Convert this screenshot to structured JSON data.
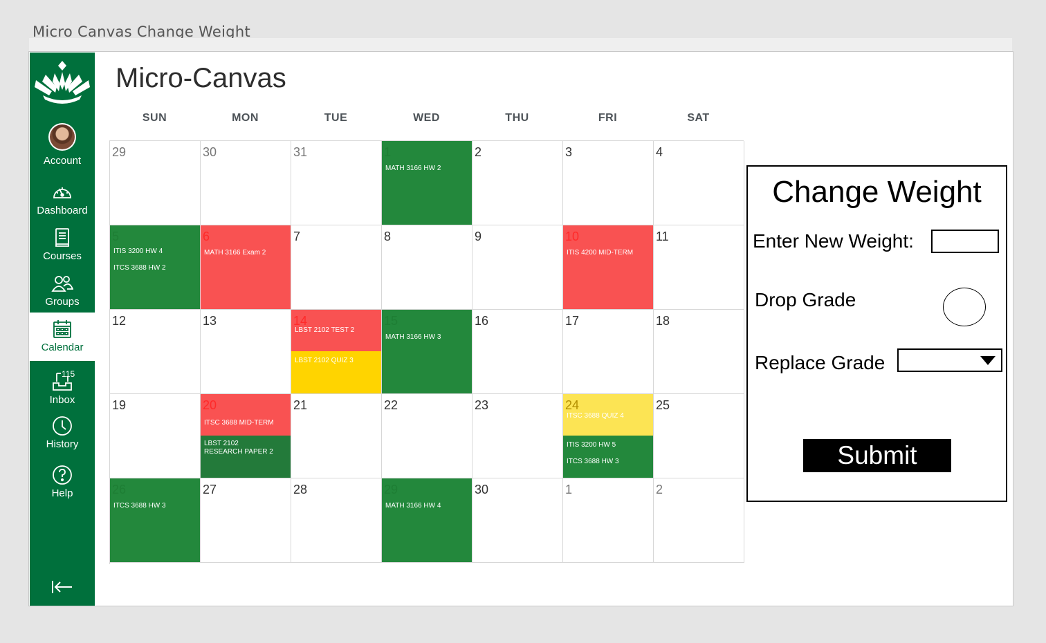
{
  "window_title": "Micro Canvas Change Weight",
  "app_title": "Micro-Canvas",
  "colors": {
    "brand": "#00703c",
    "green": "#23883c",
    "darkgreen": "#237a3a",
    "red": "#f95252",
    "yellow": "#ffd400",
    "lightyellow": "#fce454"
  },
  "sidebar": {
    "items": [
      {
        "label": "Account",
        "icon": "avatar-icon"
      },
      {
        "label": "Dashboard",
        "icon": "dashboard-icon"
      },
      {
        "label": "Courses",
        "icon": "courses-icon"
      },
      {
        "label": "Groups",
        "icon": "groups-icon"
      },
      {
        "label": "Calendar",
        "icon": "calendar-icon",
        "active": true
      },
      {
        "label": "Inbox",
        "icon": "inbox-icon",
        "badge": "115"
      },
      {
        "label": "History",
        "icon": "history-icon"
      },
      {
        "label": "Help",
        "icon": "help-icon"
      }
    ]
  },
  "calendar": {
    "days_of_week": [
      "SUN",
      "MON",
      "TUE",
      "WED",
      "THU",
      "FRI",
      "SAT"
    ],
    "weeks": [
      [
        {
          "day": "29",
          "muted": true
        },
        {
          "day": "30",
          "muted": true
        },
        {
          "day": "31",
          "muted": true
        },
        {
          "day": "1",
          "fill": "green",
          "daycolor": "green",
          "events": [
            {
              "lines": [
                "MATH 3166 HW 2"
              ]
            }
          ]
        },
        {
          "day": "2"
        },
        {
          "day": "3"
        },
        {
          "day": "4"
        }
      ],
      [
        {
          "day": "5",
          "fill": "green",
          "daycolor": "green",
          "events": [
            {
              "lines": [
                "ITIS 3200 HW 4"
              ]
            },
            {
              "lines": [
                "ITCS 3688 HW 2"
              ]
            }
          ]
        },
        {
          "day": "6",
          "fill": "red",
          "daycolor": "red",
          "events": [
            {
              "lines": [
                "MATH 3166 Exam 2"
              ]
            }
          ]
        },
        {
          "day": "7"
        },
        {
          "day": "8"
        },
        {
          "day": "9"
        },
        {
          "day": "10",
          "fill": "red",
          "daycolor": "red",
          "events": [
            {
              "lines": [
                "ITIS 4200 MID-TERM"
              ]
            }
          ]
        },
        {
          "day": "11"
        }
      ],
      [
        {
          "day": "12"
        },
        {
          "day": "13"
        },
        {
          "day": "14",
          "split": [
            "red",
            "yellow"
          ],
          "daycolor": "red",
          "events": [
            {
              "lines": [
                "LBST 2102 TEST 2"
              ]
            },
            {
              "lines": [
                "LBST 2102 QUIZ 3"
              ]
            }
          ]
        },
        {
          "day": "15",
          "fill": "green",
          "daycolor": "green",
          "events": [
            {
              "lines": [
                "MATH 3166 HW 3"
              ]
            }
          ]
        },
        {
          "day": "16"
        },
        {
          "day": "17"
        },
        {
          "day": "18"
        }
      ],
      [
        {
          "day": "19"
        },
        {
          "day": "20",
          "split": [
            "red",
            "darkgreen"
          ],
          "daycolor": "red",
          "events": [
            {
              "lines": [
                "ITSC 3688 MID-TERM"
              ]
            },
            {
              "lines": [
                "LBST 2102",
                "RESEARCH PAPER 2"
              ]
            }
          ]
        },
        {
          "day": "21"
        },
        {
          "day": "22"
        },
        {
          "day": "23"
        },
        {
          "day": "24",
          "split": [
            "lightyellow",
            "green"
          ],
          "daycolor": "gold",
          "events": [
            {
              "lines": [
                "ITSC 3688 QUIZ 4"
              ]
            },
            {
              "lines": [
                "ITIS 3200 HW 5"
              ]
            },
            {
              "lines": [
                "ITCS 3688 HW 3"
              ]
            }
          ]
        },
        {
          "day": "25"
        }
      ],
      [
        {
          "day": "26",
          "fill": "green",
          "daycolor": "green",
          "events": [
            {
              "lines": [
                "ITCS 3688 HW 3"
              ]
            }
          ]
        },
        {
          "day": "27"
        },
        {
          "day": "28"
        },
        {
          "day": "29",
          "fill": "green",
          "daycolor": "green",
          "events": [
            {
              "lines": [
                "MATH 3166 HW 4"
              ]
            }
          ]
        },
        {
          "day": "30"
        },
        {
          "day": "1",
          "muted": true
        },
        {
          "day": "2",
          "muted": true
        }
      ]
    ]
  },
  "panel": {
    "title": "Change Weight",
    "weight_label": "Enter New Weight:",
    "weight_value": "",
    "drop_label": "Drop Grade",
    "replace_label": "Replace Grade",
    "replace_selected": "",
    "submit_label": "Submit"
  }
}
